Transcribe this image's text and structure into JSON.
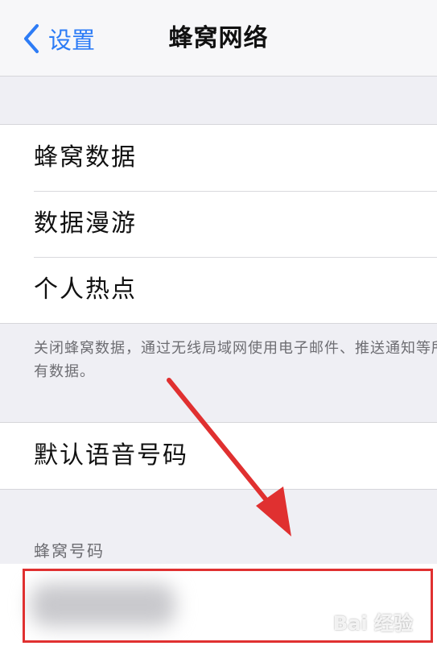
{
  "nav": {
    "back_label": "设置",
    "title": "蜂窝网络"
  },
  "groups": {
    "main": [
      "蜂窝数据",
      "数据漫游",
      "个人热点"
    ],
    "footer_note": "关闭蜂窝数据，通过无线局域网使用电子邮件、推送通知等所有数据。",
    "voice": "默认语音号码"
  },
  "section": {
    "cellular_numbers_header": "蜂窝号码"
  },
  "watermark": {
    "text": "Bai 经验"
  },
  "colors": {
    "accent": "#2d7cf6",
    "annotation": "#e03030",
    "background": "#efeff4"
  }
}
